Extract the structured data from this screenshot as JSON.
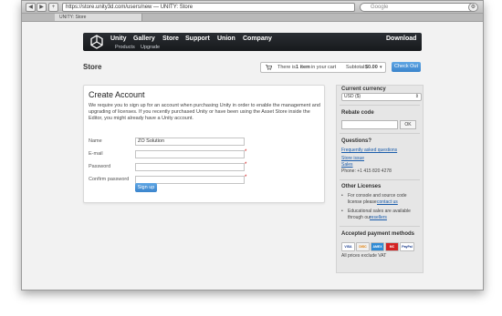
{
  "browser": {
    "url": "https://store.unity3d.com/users/new — UNITY: Store",
    "search_placeholder": "Google",
    "tab_title": "UNITY: Store"
  },
  "header": {
    "nav": [
      "Unity",
      "Gallery",
      "Store",
      "Support",
      "Union",
      "Company"
    ],
    "download": "Download",
    "subnav": [
      "Products",
      "Upgrade"
    ]
  },
  "store": {
    "title": "Store",
    "cart_prefix": "There is",
    "cart_count": "1 item",
    "cart_suffix": "in your cart",
    "subtotal_label": "Subtotal:",
    "subtotal_value": "$0.00",
    "checkout": "Check Out"
  },
  "form": {
    "title": "Create Account",
    "intro": "We require you to sign up for an account when purchasing Unity in order to enable the management and upgrading of licenses. If you recently purchased Unity or have been using the Asset Store inside the Editor, you might already have a Unity account.",
    "name_label": "Name",
    "name_value": "ZO Solution",
    "email_label": "E-mail",
    "password_label": "Password",
    "confirm_label": "Confirm password",
    "req": "*",
    "submit": "Sign up"
  },
  "sidebar": {
    "currency_title": "Current currency",
    "currency_value": "USD ($)",
    "rebate_title": "Rebate code",
    "rebate_button": "OK",
    "questions_title": "Questions?",
    "faq": "Frequently asked questions",
    "store_issue": "Store issue",
    "sales": "Sales",
    "phone": "Phone: +1 415 820 4278",
    "other_title": "Other Licenses",
    "console_a": "For console and source code",
    "console_b": "license please",
    "contact_us": "contact us",
    "edu_a": "Educational sales are available",
    "edu_b": "through our",
    "resellers": "resellers",
    "payment_title": "Accepted payment methods",
    "vat": "All prices exclude VAT",
    "cards": [
      "VISA",
      "DISC",
      "AMEX",
      "MC",
      "PayPal"
    ]
  }
}
